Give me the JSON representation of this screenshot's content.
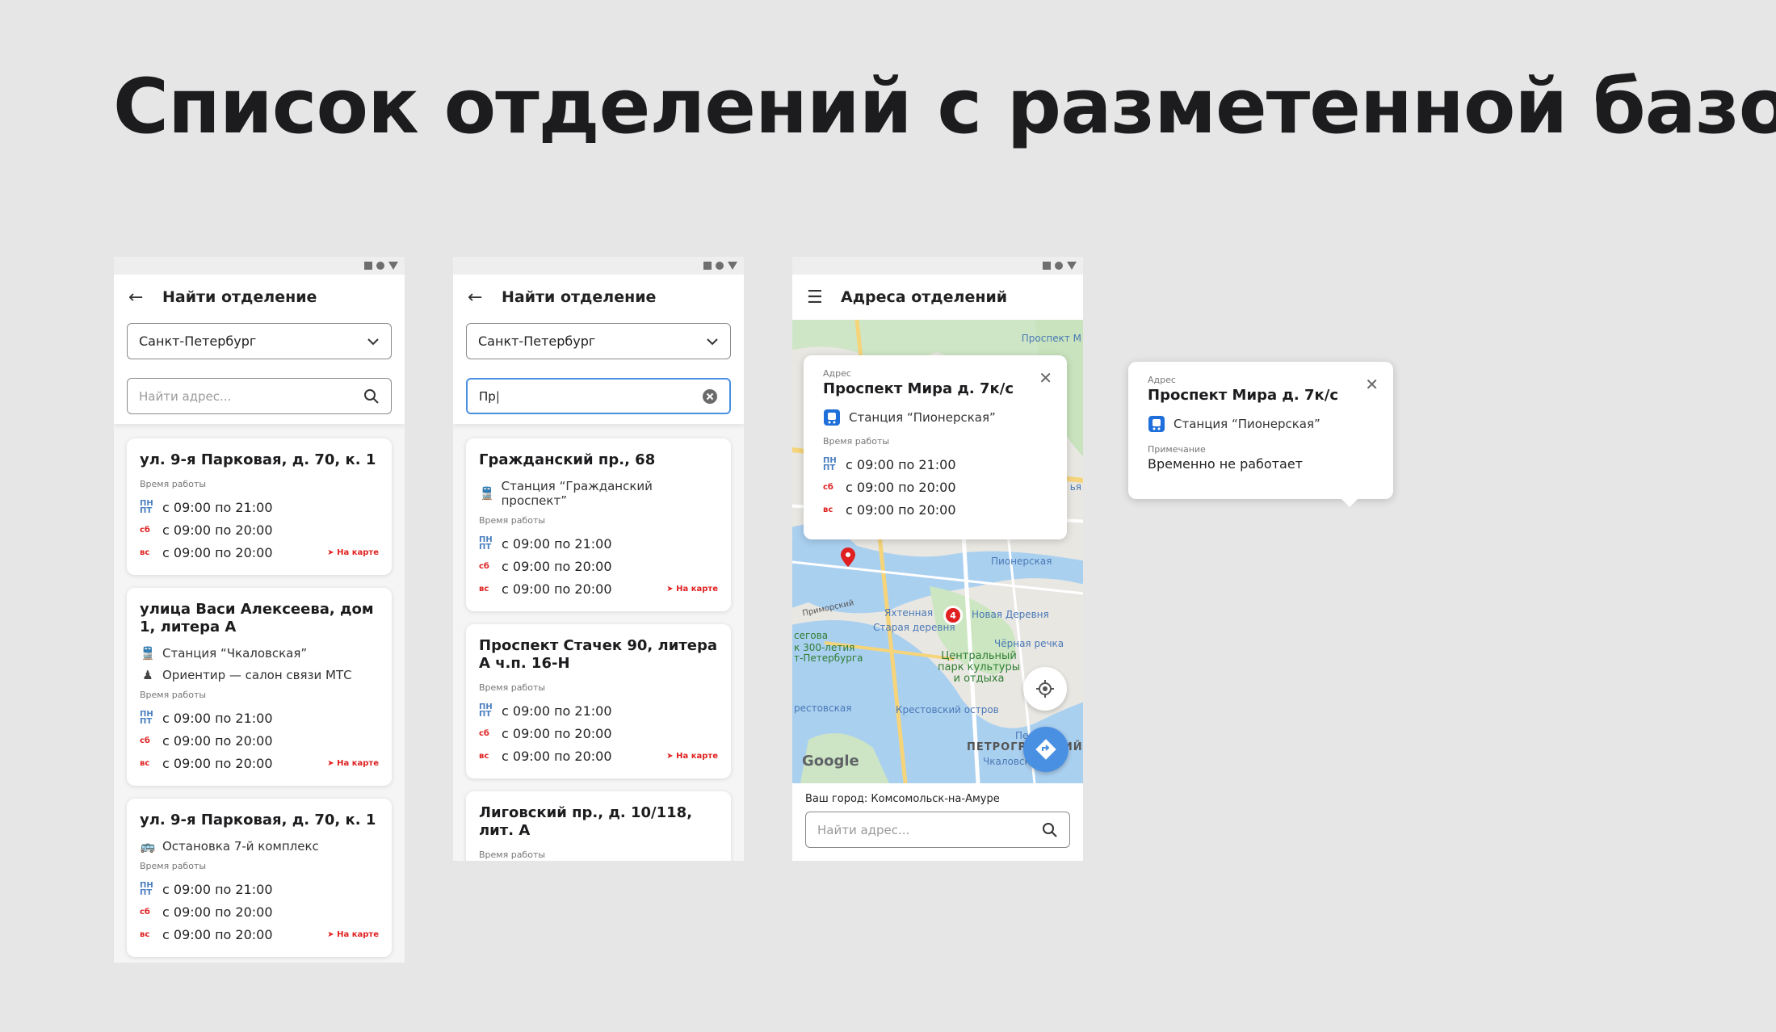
{
  "title": "Список отделений с разметенной базой",
  "labels": {
    "work_time": "Время работы",
    "on_map": "На карте",
    "mon_fri": "ПН ПТ",
    "sat": "сб",
    "sun": "вс",
    "address": "Адрес",
    "note": "Примечание"
  },
  "screen1": {
    "title": "Найти отделение",
    "city": "Санкт-Петербург",
    "search_placeholder": "Найти адрес...",
    "cards": [
      {
        "title": "ул. 9-я Парковая, д. 70, к. 1",
        "hours": [
          "с 09:00 по 21:00",
          "с 09:00 по 20:00",
          "с 09:00 по 20:00"
        ]
      },
      {
        "title": "улица Васи Алексеева, дом 1, литера А",
        "station": "Станция “Чкаловская”",
        "landmark": "Ориентир — салон связи МТС",
        "hours": [
          "с 09:00 по 21:00",
          "с 09:00 по 20:00",
          "с 09:00 по 20:00"
        ]
      },
      {
        "title": "ул. 9-я Парковая, д. 70, к. 1",
        "stop": "Остановка 7-й комплекс",
        "hours": [
          "с 09:00 по 21:00",
          "с 09:00 по 20:00",
          "с 09:00 по 20:00"
        ]
      }
    ]
  },
  "screen2": {
    "title": "Найти отделение",
    "city": "Санкт-Петербург",
    "search_value": "Пр",
    "cards": [
      {
        "title": "Гражданский пр., 68",
        "station": "Станция “Гражданский проспект”",
        "hours": [
          "с 09:00 по 21:00",
          "с 09:00 по 20:00",
          "с 09:00 по 20:00"
        ]
      },
      {
        "title": "Проспект Стачек 90, литера А ч.п. 16-Н",
        "hours": [
          "с 09:00 по 21:00",
          "с 09:00 по 20:00",
          "с 09:00 по 20:00"
        ]
      },
      {
        "title": "Лиговский пр., д. 10/118, лит. А"
      }
    ]
  },
  "screen3": {
    "title": "Адреса отделений",
    "popup": {
      "title": "Проспект Мира д. 7к/с",
      "station": "Станция “Пионерская”",
      "hours": [
        "с 09:00 по 21:00",
        "с 09:00 по 20:00",
        "с 09:00 по 20:00"
      ]
    },
    "map_labels": {
      "l1": "Проспект М",
      "l2": "Пионерская",
      "l3": "Яхтенная",
      "l4": "Новая Деревня",
      "l5": "Старая деревня",
      "l6": "Приморский",
      "l7": "Центральный парк культуры и отдыха",
      "l8": "Чёрная речка",
      "l9": "Крестовский остров",
      "l10": "рестовская",
      "l11": "ПЕТРОГРАДСКИЙ",
      "l12": "Чкаловская",
      "l13": "к 300-летия т-Петербурга",
      "l14": "сегова",
      "l15": "Google",
      "l16": "ья",
      "l17": "Пе"
    },
    "marker_count": "4",
    "city_label": "Ваш город:",
    "city_value": "Комсомольск-на-Амуре",
    "search_placeholder": "Найти адрес..."
  },
  "popup_standalone": {
    "title": "Проспект Мира д. 7к/с",
    "station": "Станция “Пионерская”",
    "note": "Временно не работает"
  },
  "colors": {
    "accent_blue": "#4a90e2",
    "weekend_red": "#e02020",
    "weekday_blue": "#4a7fc1",
    "metro_blue": "#1e6fd9"
  }
}
